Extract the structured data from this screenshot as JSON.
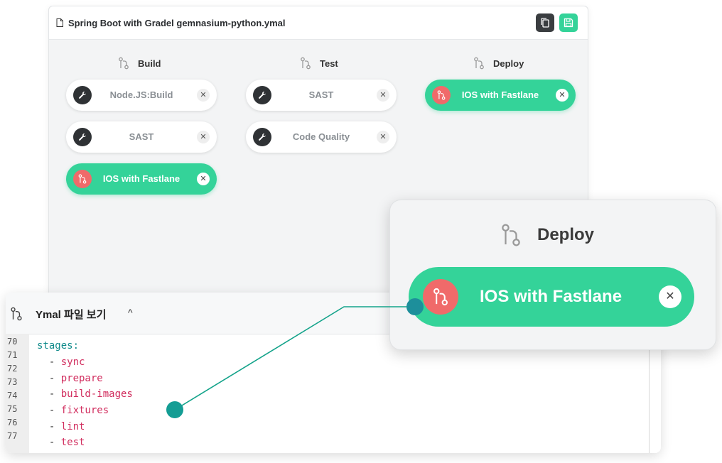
{
  "window": {
    "title": "Spring Boot with Gradel gemnasium-python.ymal",
    "copy_icon": "copy-icon",
    "save_icon": "save-icon"
  },
  "stages": [
    {
      "name": "Build",
      "jobs": [
        {
          "label": "Node.JS:Build",
          "active": false
        },
        {
          "label": "SAST",
          "active": false
        },
        {
          "label": "IOS with Fastlane",
          "active": true
        }
      ]
    },
    {
      "name": "Test",
      "jobs": [
        {
          "label": "SAST",
          "active": false
        },
        {
          "label": "Code Quality",
          "active": false
        }
      ]
    },
    {
      "name": "Deploy",
      "jobs": [
        {
          "label": "IOS with Fastlane",
          "active": true
        }
      ]
    }
  ],
  "zoom": {
    "stage": "Deploy",
    "job": "IOS with Fastlane"
  },
  "yaml_panel": {
    "title": "Ymal 파일 보기",
    "toggle": "^",
    "line_numbers": [
      "70",
      "71",
      "72",
      "73",
      "74",
      "75",
      "76",
      "77"
    ],
    "key": "stages:",
    "items": [
      "sync",
      "prepare",
      "build-images",
      "fixtures",
      "lint",
      "test"
    ]
  },
  "colors": {
    "accent": "#34d399",
    "job_icon": "#f06a6a",
    "yaml_key": "#0f8a8a",
    "yaml_value": "#d12d5e"
  }
}
